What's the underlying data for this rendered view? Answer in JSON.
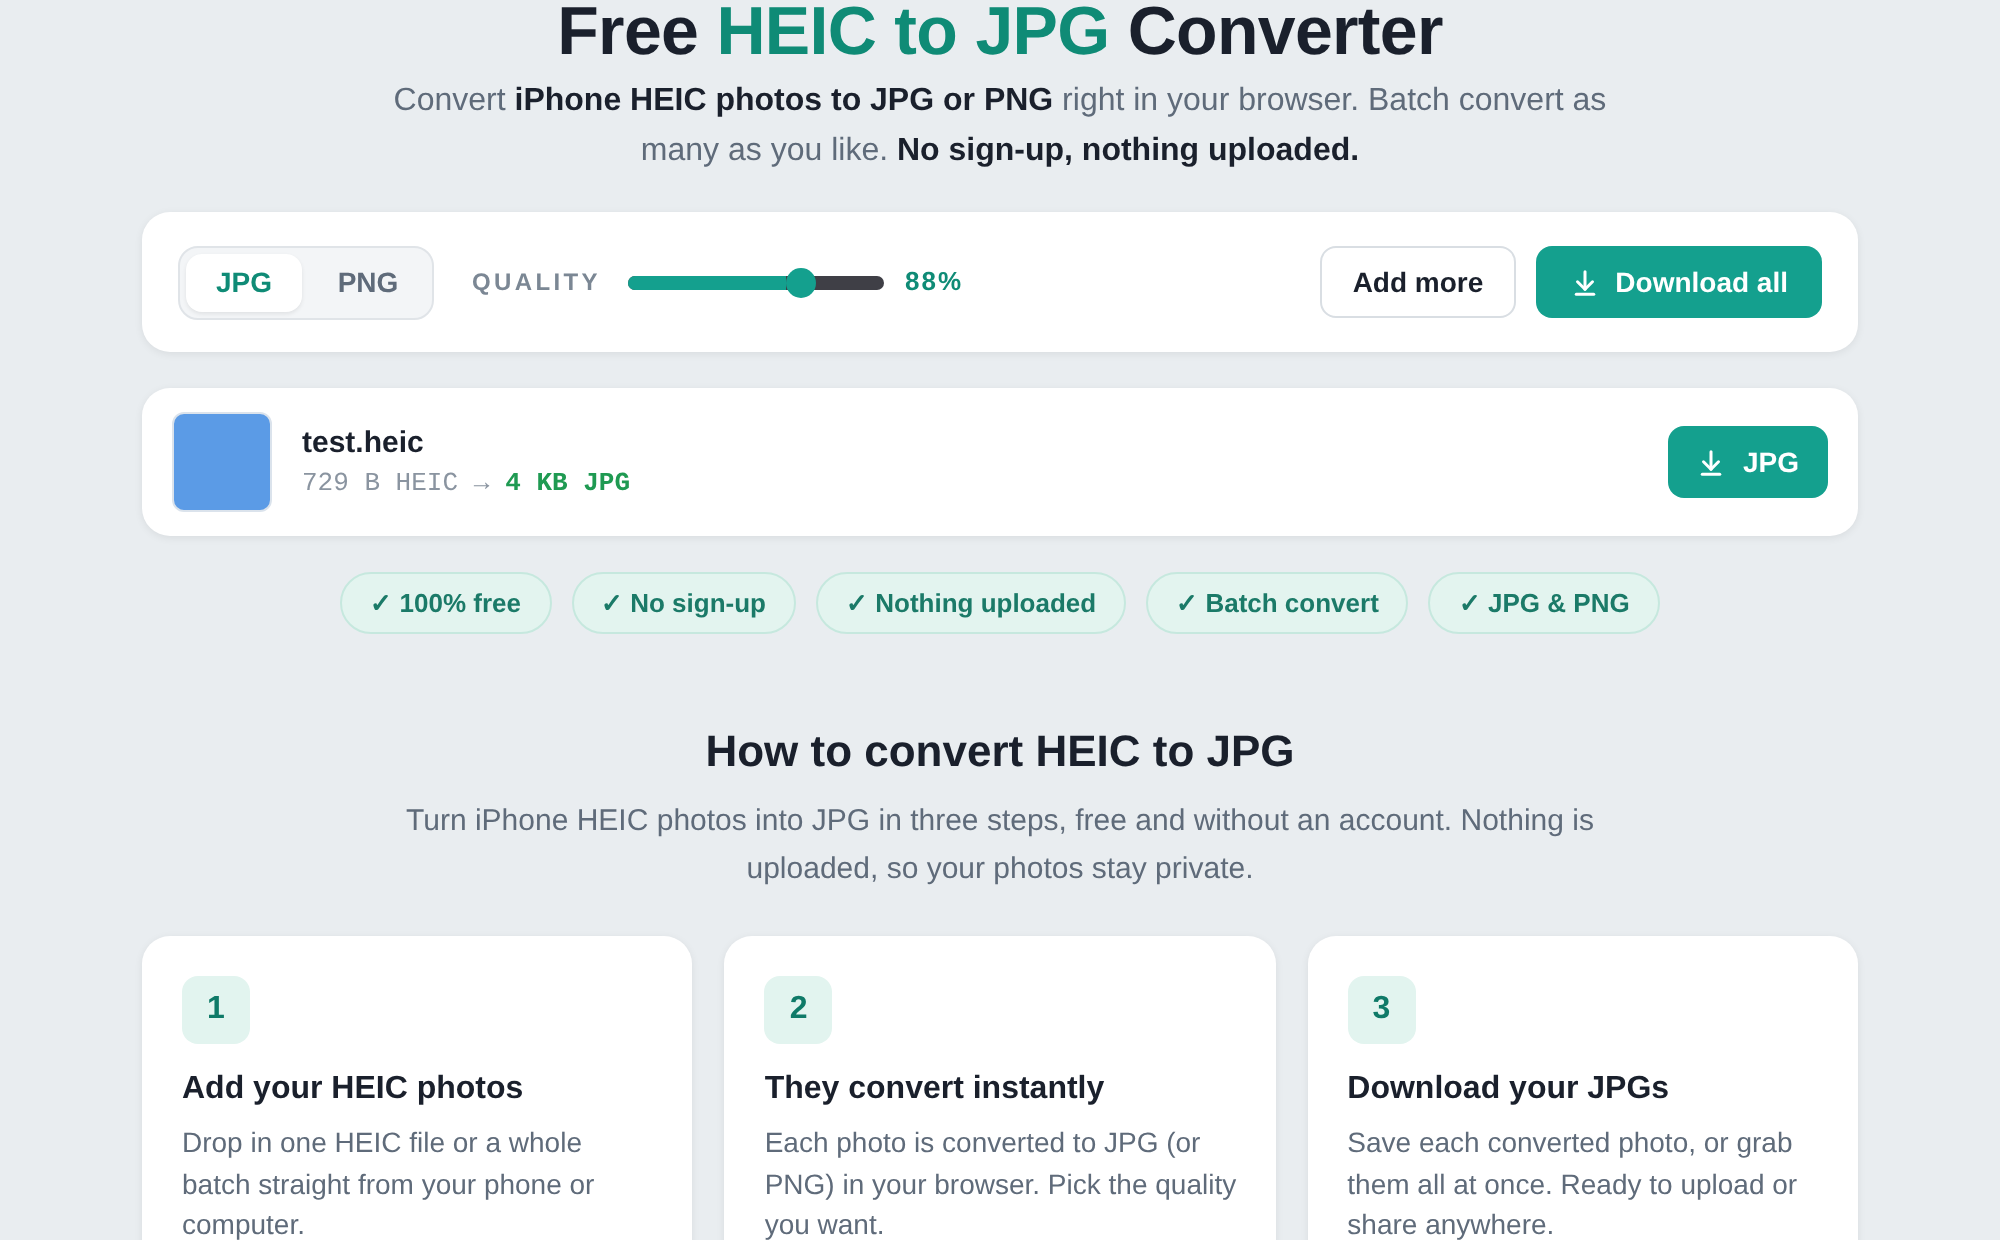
{
  "title_parts": [
    {
      "text": "Free",
      "highlighted": false
    },
    {
      "text": "HEIC to JPG",
      "highlighted": true
    },
    {
      "text": "Converter",
      "highlighted": false
    }
  ],
  "subtitle": "Convert **iPhone HEIC photos to JPG or PNG** right in your browser. Batch convert as many as you like. **No sign-up, nothing uploaded.**",
  "toolbar": {
    "formats": [
      {
        "label": "JPG",
        "selected": true
      },
      {
        "label": "PNG",
        "selected": false
      }
    ],
    "quality": {
      "label": "QUALITY",
      "level": 0.67,
      "reading": "88%"
    },
    "buttons": [
      {
        "label": "Add more",
        "kind": "secondary"
      },
      {
        "label": "Download all",
        "kind": "primary"
      }
    ]
  },
  "files": [
    {
      "name": "test.heic",
      "original": "729 B HEIC →",
      "converted": "4 KB JPG",
      "button": "JPG"
    }
  ],
  "features": [
    "✓ 100% free",
    "✓ No sign-up",
    "✓ Nothing uploaded",
    "✓ Batch convert",
    "✓ JPG & PNG"
  ],
  "how_to": {
    "heading": "How to convert HEIC to JPG",
    "intro": "Turn iPhone HEIC photos into JPG in three steps, free and without an account. Nothing is uploaded, so your photos stay private.",
    "steps": [
      {
        "number": "1",
        "title": "Add your HEIC photos",
        "description": "Drop in one HEIC file or a whole batch straight from your phone or computer."
      },
      {
        "number": "2",
        "title": "They convert instantly",
        "description": "Each photo is converted to JPG (or PNG) in your browser. Pick the quality you want."
      },
      {
        "number": "3",
        "title": "Download your JPGs",
        "description": "Save each converted photo, or grab them all at once. Ready to upload or share anywhere."
      }
    ]
  }
}
